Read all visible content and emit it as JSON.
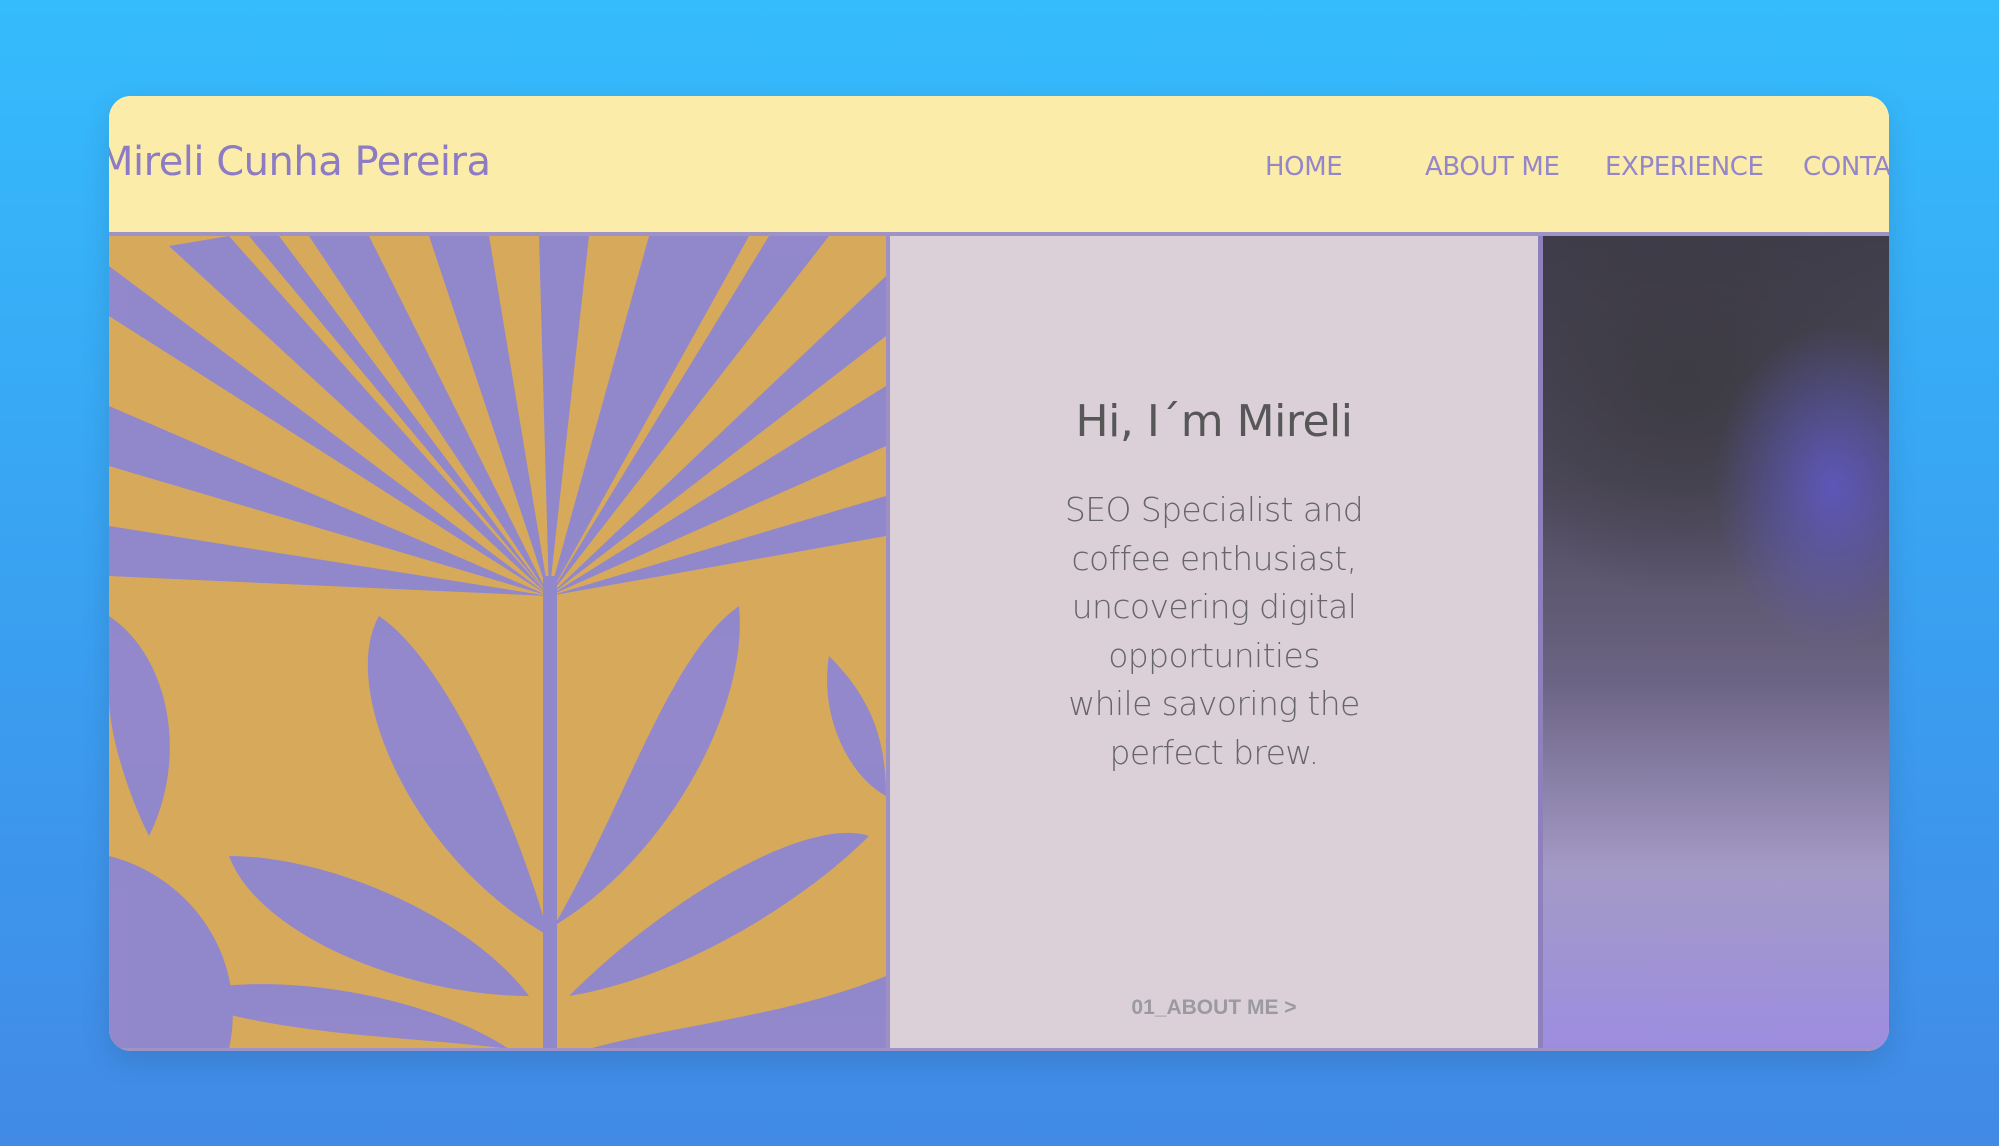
{
  "header": {
    "brand": "Mireli Cunha Pereira",
    "nav": [
      {
        "label": "HOME"
      },
      {
        "label": "ABOUT ME"
      },
      {
        "label": "EXPERIENCE"
      },
      {
        "label": "CONTA"
      }
    ]
  },
  "hero": {
    "title": "Hi, I´m Mireli",
    "description": "SEO Specialist and coffee enthusiast, uncovering digital opportunities while savoring the perfect brew.",
    "link": "01_ABOUT ME >"
  },
  "colors": {
    "background": "#35bcfd",
    "header": "#fbeda9",
    "brand_text": "#8d7cc3",
    "hero_panel": "#dbd0d8",
    "accent_purple": "#9e92c7"
  }
}
